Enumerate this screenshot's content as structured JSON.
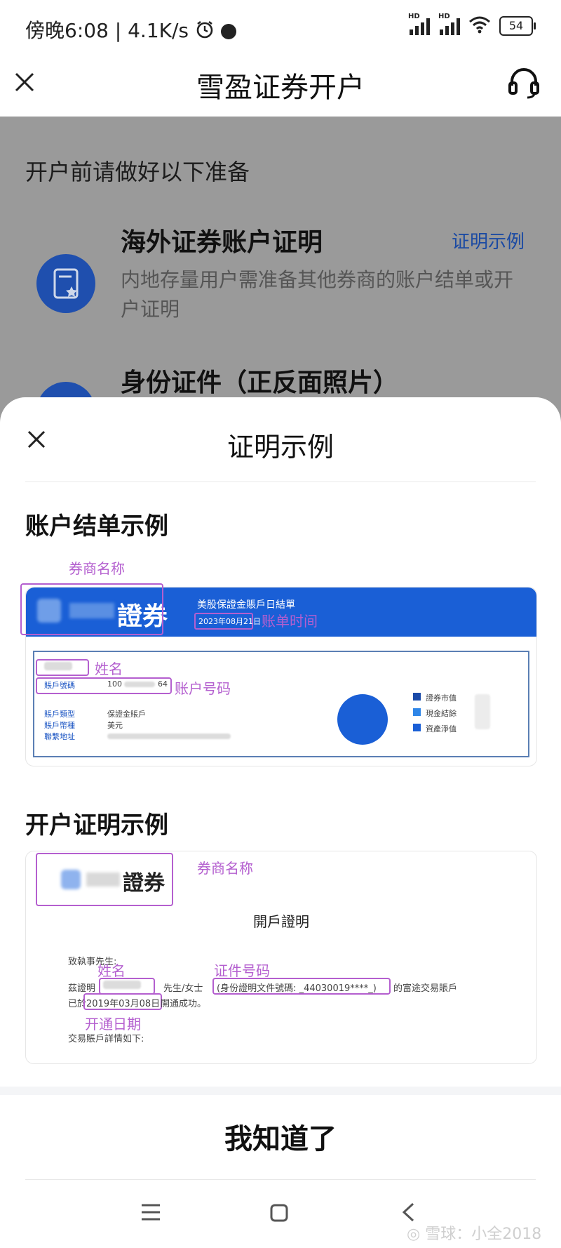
{
  "status_bar": {
    "time_text": "傍晚6:08 | 4.1K/s",
    "network_labels": [
      "HD",
      "HD"
    ],
    "battery": "54"
  },
  "header": {
    "title": "雪盈证券开户"
  },
  "background_page": {
    "heading": "开户前请做好以下准备",
    "items": [
      {
        "title": "海外证券账户证明",
        "link": "证明示例",
        "desc": "内地存量用户需准备其他券商的账户结单或开户证明"
      },
      {
        "title": "身份证件（正反面照片）"
      }
    ]
  },
  "sheet": {
    "title": "证明示例",
    "statement_section": {
      "title": "账户结单示例",
      "labels": {
        "broker_name": "券商名称",
        "statement_time": "账单时间",
        "name": "姓名",
        "account_number": "账户号码"
      },
      "doc": {
        "broker_suffix": "證券",
        "doc_title": "美股保證金賬戶日結單",
        "doc_date": "2023年08月21日",
        "account_label": "賬戶號碼",
        "account_value_prefix": "100",
        "account_value_suffix": "64",
        "details": [
          {
            "key": "賬戶類型",
            "value": "保證金賬戶"
          },
          {
            "key": "賬戶幣種",
            "value": "美元"
          },
          {
            "key": "聯繫地址",
            "value": ""
          }
        ],
        "legend": [
          "證券市值",
          "現金結餘",
          "資產淨值"
        ]
      }
    },
    "opening_section": {
      "title": "开户证明示例",
      "labels": {
        "broker_name": "券商名称",
        "name": "姓名",
        "id_number": "证件号码",
        "open_date": "开通日期"
      },
      "doc": {
        "broker_suffix": "證券",
        "doc_title": "開戶證明",
        "salutation": "致執事先生:",
        "line1_prefix": "茲證明",
        "line1_gender": "先生/女士",
        "line1_id": "(身份證明文件號碼: _44030019****_)",
        "line1_suffix": "的富途交易賬戶",
        "line2_prefix": "已於",
        "line2_date": "2019年03月08日",
        "line2_suffix": "開通成功。",
        "line3": "交易賬戶詳情如下:"
      }
    },
    "confirm_button": "我知道了"
  },
  "watermark": "雪球：小全2018",
  "colors": {
    "brand_blue": "#1a5fd6",
    "annotation_purple": "#b45fcf",
    "overlay_gray": "#9a9a9a"
  },
  "icons": [
    "close-icon",
    "headset-icon",
    "document-star-icon",
    "menu-icon",
    "home-icon",
    "back-icon",
    "alarm-icon",
    "wifi-icon"
  ]
}
